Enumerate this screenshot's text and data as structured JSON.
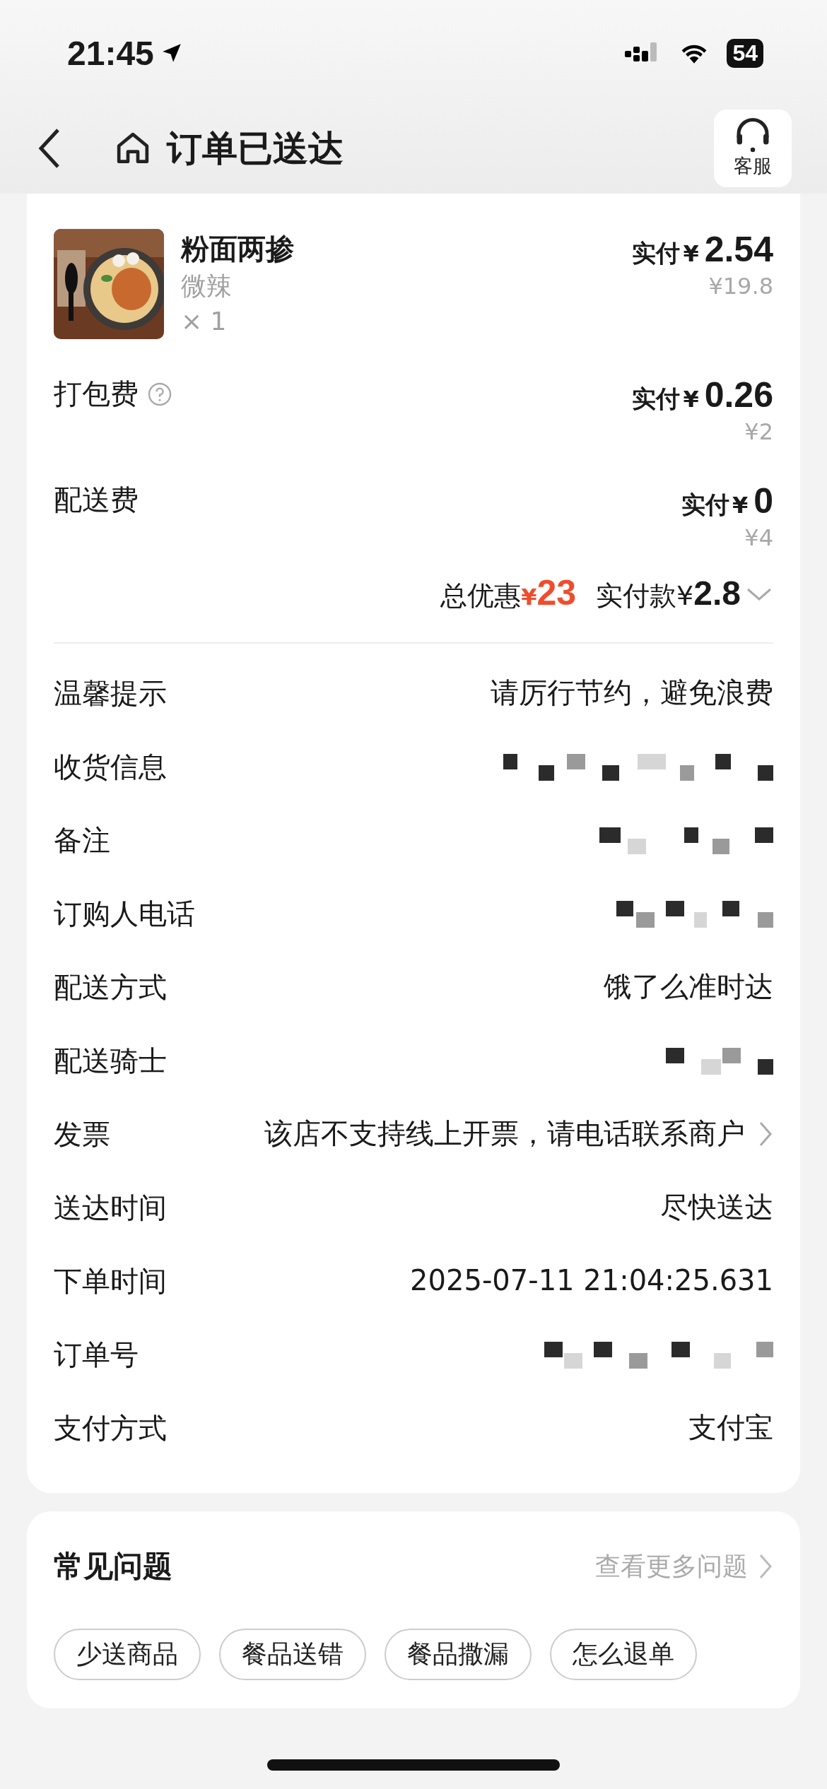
{
  "status_bar": {
    "time": "21:45",
    "battery": "54"
  },
  "header": {
    "title": "订单已送达",
    "service_label": "客服"
  },
  "product": {
    "name": "粉面两掺",
    "spec": "微辣",
    "quantity": "× 1",
    "paid_label": "实付",
    "currency": "¥",
    "paid": "2.54",
    "original": "¥19.8"
  },
  "fees": [
    {
      "label": "打包费",
      "help": true,
      "paid_label": "实付",
      "currency": "¥",
      "paid": "0.26",
      "original": "¥2"
    },
    {
      "label": "配送费",
      "help": false,
      "paid_label": "实付",
      "currency": "¥",
      "paid": "0",
      "original": "¥4"
    }
  ],
  "summary": {
    "discount_label": "总优惠",
    "discount_currency": "¥",
    "discount": "23",
    "total_label": "实付款¥",
    "total": "2.8"
  },
  "info_rows": [
    {
      "label": "温馨提示",
      "kind": "text",
      "value": "请厉行节约，避免浪费",
      "link": false
    },
    {
      "label": "收货信息",
      "kind": "redacted"
    },
    {
      "label": "备注",
      "kind": "redacted"
    },
    {
      "label": "订购人电话",
      "kind": "redacted"
    },
    {
      "label": "配送方式",
      "kind": "text",
      "value": "饿了么准时达",
      "link": false
    },
    {
      "label": "配送骑士",
      "kind": "redacted"
    },
    {
      "label": "发票",
      "kind": "text",
      "value": "该店不支持线上开票，请电话联系商户",
      "link": true
    },
    {
      "label": "送达时间",
      "kind": "text",
      "value": "尽快送达",
      "link": false
    },
    {
      "label": "下单时间",
      "kind": "text",
      "value": "2025-07-11 21:04:25.631",
      "link": false
    },
    {
      "label": "订单号",
      "kind": "redacted"
    },
    {
      "label": "支付方式",
      "kind": "text",
      "value": "支付宝",
      "link": false
    }
  ],
  "faq": {
    "title": "常见问题",
    "more": "查看更多问题",
    "chips": [
      "少送商品",
      "餐品送错",
      "餐品撒漏",
      "怎么退单"
    ]
  }
}
